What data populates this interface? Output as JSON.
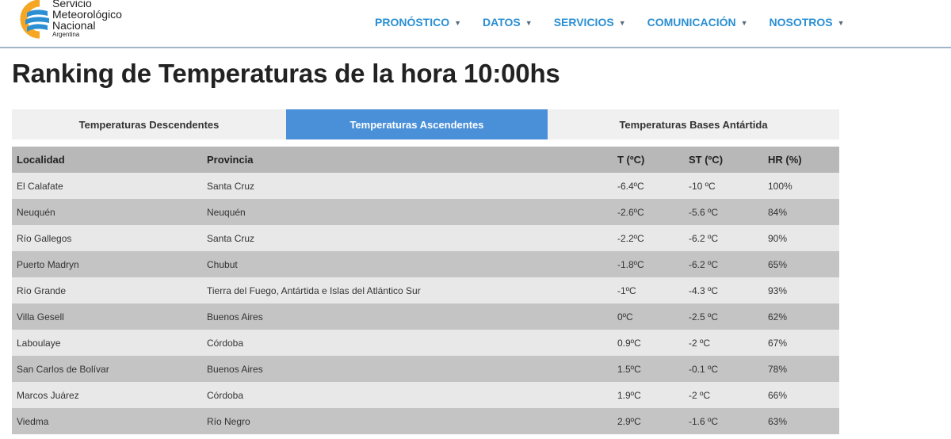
{
  "header": {
    "logo": {
      "line1": "Servicio",
      "line2": "Meteorológico",
      "line3": "Nacional",
      "line4": "Argentina"
    },
    "nav": [
      {
        "label": "PRONÓSTICO"
      },
      {
        "label": "DATOS"
      },
      {
        "label": "SERVICIOS"
      },
      {
        "label": "COMUNICACIÓN"
      },
      {
        "label": "NOSOTROS"
      }
    ]
  },
  "page_title": "Ranking de Temperaturas de la hora 10:00hs",
  "tabs": [
    {
      "label": "Temperaturas Descendentes"
    },
    {
      "label": "Temperaturas Ascendentes",
      "active": true
    },
    {
      "label": "Temperaturas Bases Antártida"
    }
  ],
  "table": {
    "headers": [
      "Localidad",
      "Provincia",
      "T (ºC)",
      "ST (ºC)",
      "HR (%)"
    ],
    "rows": [
      [
        "El Calafate",
        "Santa Cruz",
        "-6.4ºC",
        "-10 ºC",
        "100%"
      ],
      [
        "Neuquén",
        "Neuquén",
        "-2.6ºC",
        "-5.6 ºC",
        "84%"
      ],
      [
        "Río Gallegos",
        "Santa Cruz",
        "-2.2ºC",
        "-6.2 ºC",
        "90%"
      ],
      [
        "Puerto Madryn",
        "Chubut",
        "-1.8ºC",
        "-6.2 ºC",
        "65%"
      ],
      [
        "Río Grande",
        "Tierra del Fuego, Antártida e Islas del Atlántico Sur",
        "-1ºC",
        "-4.3 ºC",
        "93%"
      ],
      [
        "Villa Gesell",
        "Buenos Aires",
        "0ºC",
        "-2.5 ºC",
        "62%"
      ],
      [
        "Laboulaye",
        "Córdoba",
        "0.9ºC",
        "-2 ºC",
        "67%"
      ],
      [
        "San Carlos de Bolívar",
        "Buenos Aires",
        "1.5ºC",
        "-0.1 ºC",
        "78%"
      ],
      [
        "Marcos Juárez",
        "Córdoba",
        "1.9ºC",
        "-2 ºC",
        "66%"
      ],
      [
        "Viedma",
        "Río Negro",
        "2.9ºC",
        "-1.6 ºC",
        "63%"
      ]
    ]
  },
  "colors": {
    "nav_text": "#2a8fd3",
    "active_tab": "#4a90d9",
    "header_row": "#b8b8b8",
    "row_light": "#e8e8e8",
    "row_dark": "#c4c4c4",
    "logo_blue": "#2a8fd3",
    "logo_orange": "#f5a623"
  }
}
